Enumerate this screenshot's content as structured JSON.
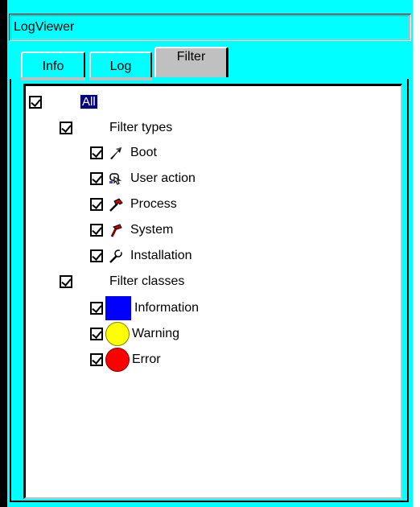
{
  "window": {
    "title": "LogViewer"
  },
  "tabs": [
    {
      "label": "Info",
      "active": false
    },
    {
      "label": "Log",
      "active": false
    },
    {
      "label": "Filter",
      "active": true
    }
  ],
  "tree": {
    "root": {
      "label": "All",
      "checked": true,
      "selected": true
    },
    "filter_types": {
      "label": "Filter types",
      "checked": true,
      "items": [
        {
          "label": "Boot",
          "checked": true,
          "icon": "boot-icon"
        },
        {
          "label": "User action",
          "checked": true,
          "icon": "user-action-icon"
        },
        {
          "label": "Process",
          "checked": true,
          "icon": "process-icon"
        },
        {
          "label": "System",
          "checked": true,
          "icon": "system-icon"
        },
        {
          "label": "Installation",
          "checked": true,
          "icon": "installation-icon"
        }
      ]
    },
    "filter_classes": {
      "label": "Filter classes",
      "checked": true,
      "items": [
        {
          "label": "Information",
          "checked": true,
          "icon": "information-square-icon",
          "color": "#0000ff"
        },
        {
          "label": "Warning",
          "checked": true,
          "icon": "warning-circle-icon",
          "color": "#ffff00"
        },
        {
          "label": "Error",
          "checked": true,
          "icon": "error-circle-icon",
          "color": "#ff0000"
        }
      ]
    }
  }
}
